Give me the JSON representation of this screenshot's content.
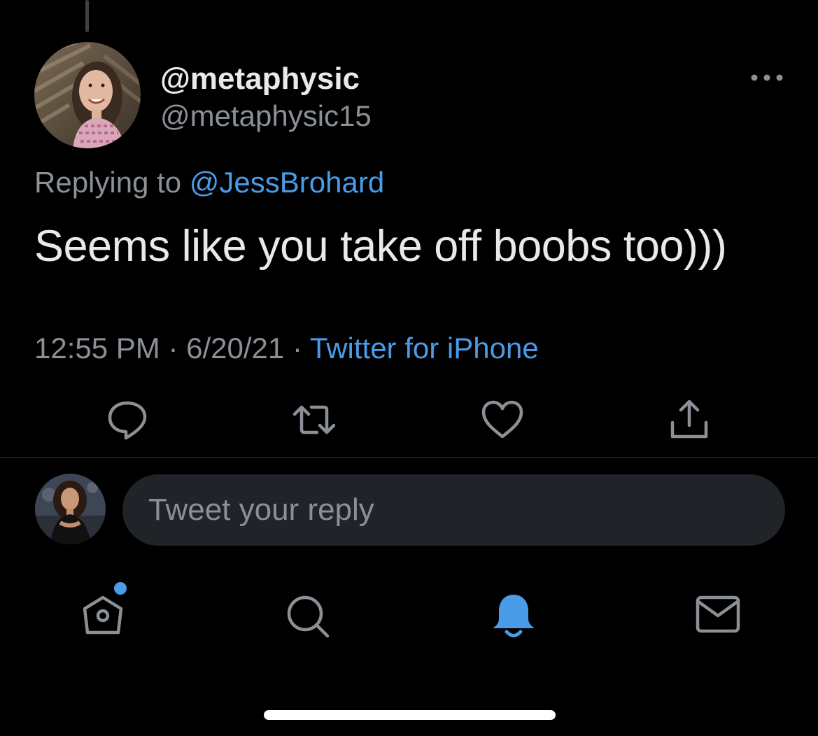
{
  "tweet": {
    "display_name": "@metaphysic",
    "handle": "@metaphysic15",
    "replying_prefix": "Replying to",
    "replying_to": "@JessBrohard",
    "text": "Seems like you take off boobs too)))",
    "time": "12:55 PM",
    "separator": "·",
    "date": "6/20/21",
    "source": "Twitter for iPhone"
  },
  "actions": [
    {
      "name": "reply",
      "icon": "speech-bubble-icon"
    },
    {
      "name": "retweet",
      "icon": "retweet-icon"
    },
    {
      "name": "like",
      "icon": "heart-icon"
    },
    {
      "name": "share",
      "icon": "share-icon"
    }
  ],
  "reply_composer": {
    "placeholder": "Tweet your reply"
  },
  "tab_bar": [
    {
      "name": "home",
      "icon": "home-icon",
      "active": false,
      "has_badge": true
    },
    {
      "name": "search",
      "icon": "search-icon",
      "active": false
    },
    {
      "name": "notifications",
      "icon": "bell-icon",
      "active": true
    },
    {
      "name": "messages",
      "icon": "mail-icon",
      "active": false
    }
  ],
  "colors": {
    "background": "#000000",
    "text_primary": "#e7e9ea",
    "text_secondary": "#8b9096",
    "accent": "#4a9be8",
    "input_bg": "#202327",
    "divider": "#2f3336"
  }
}
